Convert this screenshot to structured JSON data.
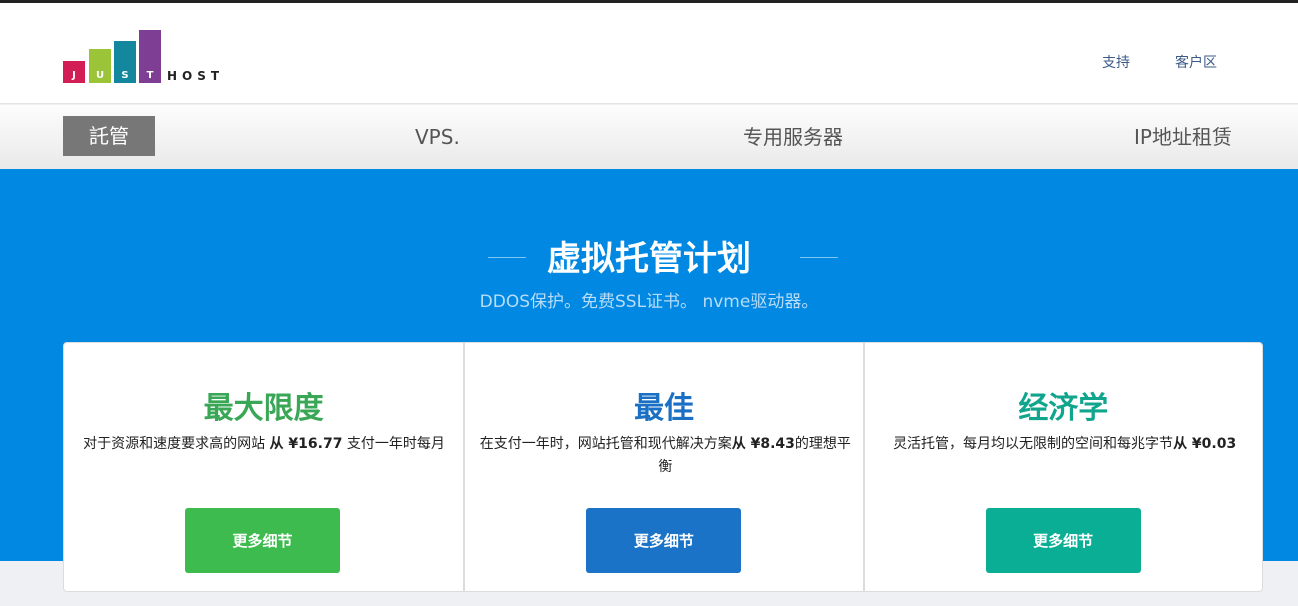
{
  "logo": {
    "letters": [
      "J",
      "U",
      "S",
      "T"
    ],
    "colors": [
      "#d31d55",
      "#9bc438",
      "#12879d",
      "#7e3e94"
    ],
    "text": "HOST"
  },
  "header": {
    "links": [
      "支持",
      "客户区"
    ]
  },
  "nav": {
    "items": [
      "託管",
      "VPS.",
      "专用服务器",
      "IP地址租赁"
    ],
    "active": 0
  },
  "hero": {
    "title": "虚拟托管计划",
    "subtitle": "DDOS保护。免费SSL证书。 nvme驱动器。"
  },
  "plans": [
    {
      "title": "最大限度",
      "color": "#3aa757",
      "desc_before": "对于资源和速度要求高的网站 ",
      "price": "从 ¥16.77",
      "desc_after": " 支付一年时每月",
      "button": "更多细节",
      "button_color": "#3dbb4e"
    },
    {
      "title": "最佳",
      "color": "#1a70c4",
      "desc_before": "在支付一年时，网站托管和现代解决方案",
      "price": "从 ¥8.43",
      "desc_after": "的理想平衡",
      "button": "更多细节",
      "button_color": "#1a73c6"
    },
    {
      "title": "经济学",
      "color": "#11a58e",
      "desc_before": "灵活托管，每月均以无限制的空间和每兆字节",
      "price": "从 ¥0.03",
      "desc_after": "",
      "button": "更多细节",
      "button_color": "#0aae95"
    }
  ]
}
